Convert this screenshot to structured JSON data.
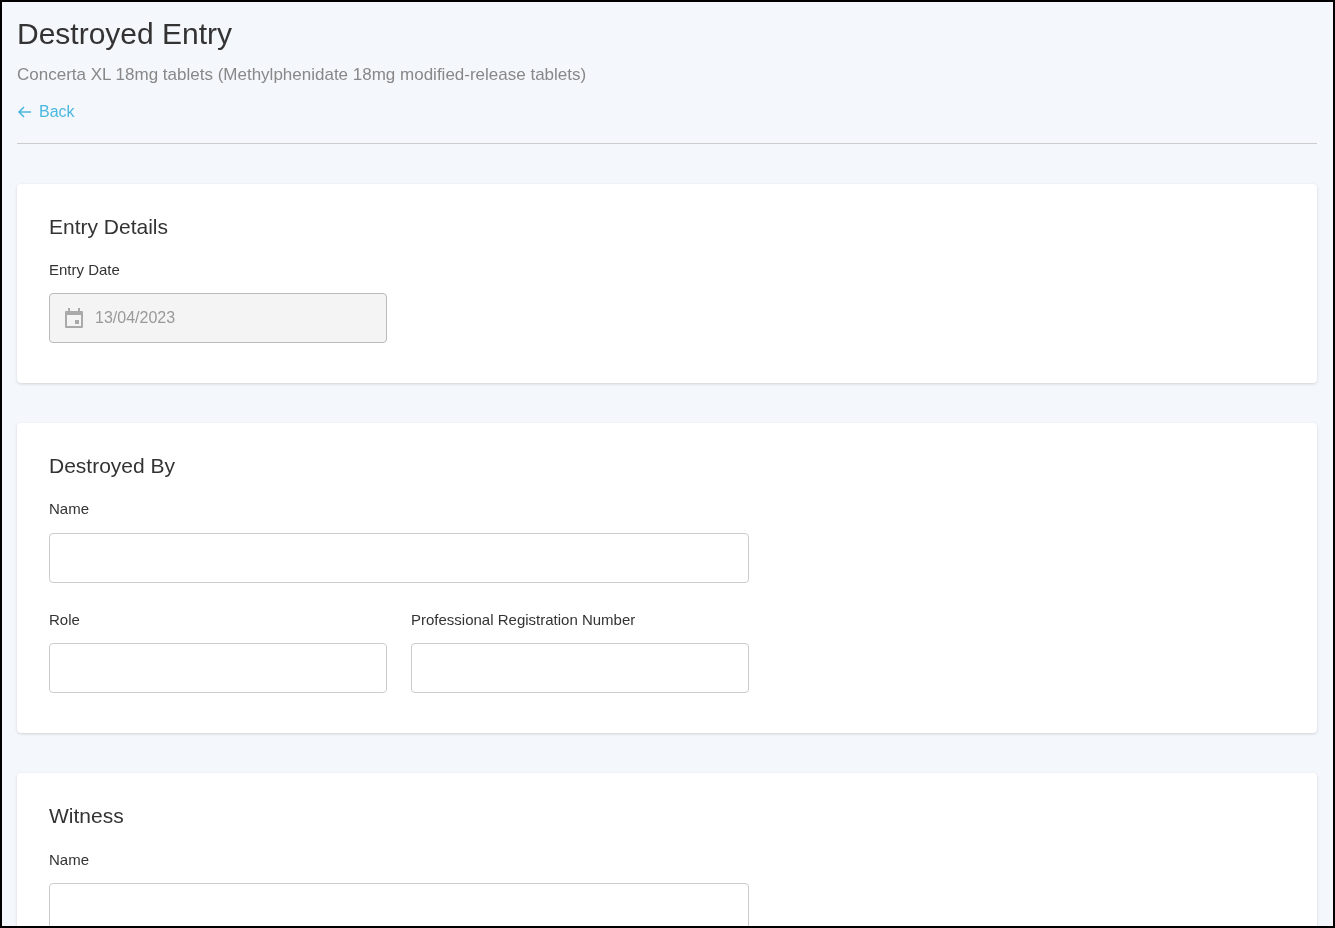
{
  "header": {
    "title": "Destroyed Entry",
    "subtitle": "Concerta XL 18mg tablets (Methylphenidate 18mg modified-release tablets)",
    "back_link": "Back"
  },
  "sections": [
    {
      "title": "Entry Details",
      "rows": [
        [
          {
            "kind": "date",
            "label": "Entry Date",
            "value": "13/04/2023",
            "disabled": true
          }
        ]
      ]
    },
    {
      "title": "Destroyed By",
      "rows": [
        [
          {
            "kind": "text",
            "label": "Name",
            "disabled": false,
            "wide": true
          }
        ],
        [
          {
            "kind": "text",
            "label": "Role",
            "disabled": false
          },
          {
            "kind": "text",
            "label": "Professional Registration Number",
            "disabled": false
          }
        ]
      ]
    },
    {
      "title": "Witness",
      "rows": [
        [
          {
            "kind": "text",
            "label": "Name",
            "disabled": false,
            "wide": true
          }
        ]
      ]
    }
  ]
}
